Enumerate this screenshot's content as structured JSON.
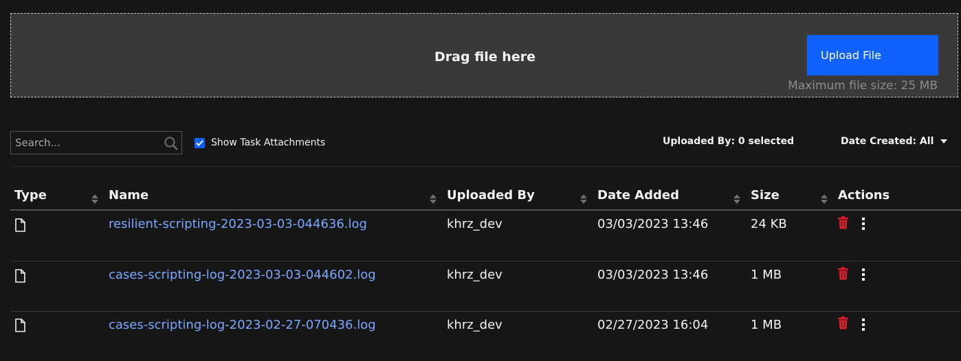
{
  "upload": {
    "drag_text": "Drag file here",
    "button_label": "Upload File",
    "max_size": "Maximum file size: 25 MB"
  },
  "toolbar": {
    "search_placeholder": "Search...",
    "show_task_label": "Show Task Attachments",
    "show_task_checked": true,
    "uploaded_by_filter": "Uploaded By: 0 selected",
    "date_created_filter": "Date Created: All"
  },
  "table": {
    "headers": [
      "Type",
      "Name",
      "Uploaded By",
      "Date Added",
      "Size",
      "Actions"
    ],
    "rows": [
      {
        "name": "resilient-scripting-2023-03-03-044636.log",
        "uploaded_by": "khrz_dev",
        "date_added": "03/03/2023 13:46",
        "size": "24 KB"
      },
      {
        "name": "cases-scripting-log-2023-03-03-044602.log",
        "uploaded_by": "khrz_dev",
        "date_added": "03/03/2023 13:46",
        "size": "1 MB"
      },
      {
        "name": "cases-scripting-log-2023-02-27-070436.log",
        "uploaded_by": "khrz_dev",
        "date_added": "02/27/2023 16:04",
        "size": "1 MB"
      }
    ]
  },
  "colors": {
    "accent": "#0f62fe",
    "link": "#78a9ff",
    "danger": "#da1e28",
    "background": "#161616"
  }
}
